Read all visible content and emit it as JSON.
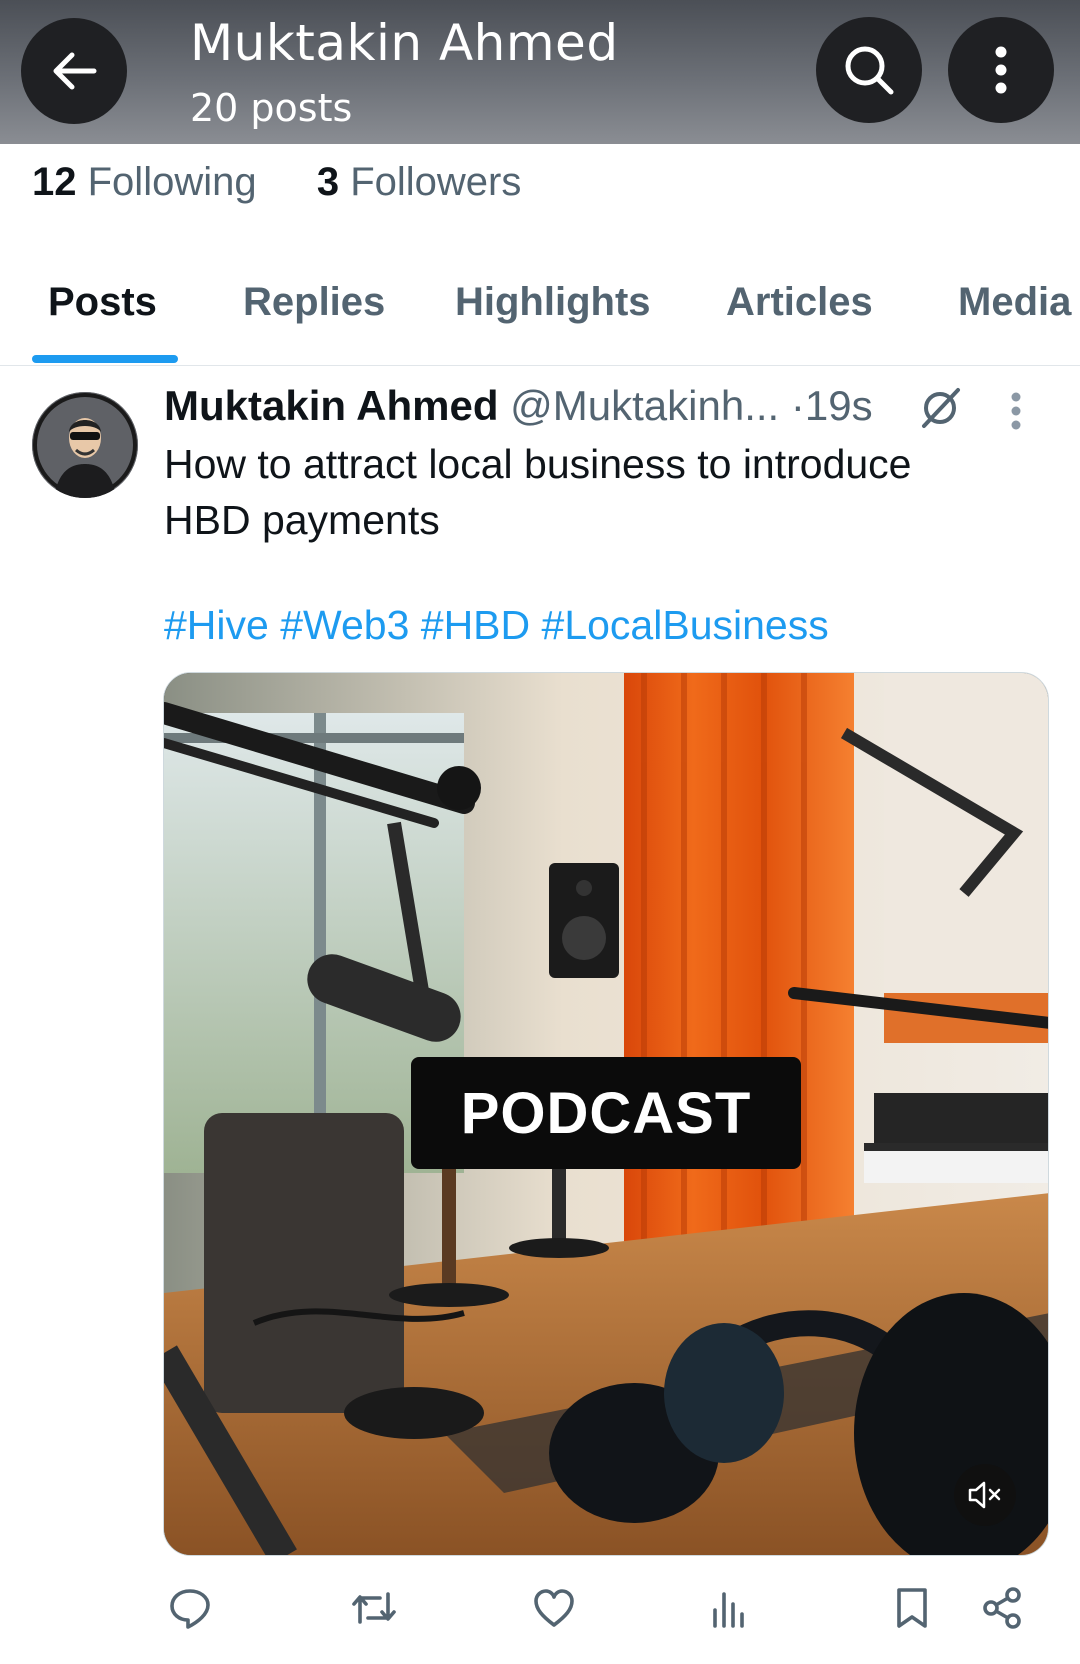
{
  "header": {
    "name": "Muktakin Ahmed",
    "posts_count": "20 posts",
    "back_icon": "arrow-left-icon",
    "search_icon": "search-icon",
    "more_icon": "more-vertical-icon"
  },
  "stats": {
    "following_count": "12",
    "following_label": "Following",
    "followers_count": "3",
    "followers_label": "Followers"
  },
  "tabs": [
    {
      "label": "Posts",
      "active": true
    },
    {
      "label": "Replies",
      "active": false
    },
    {
      "label": "Highlights",
      "active": false
    },
    {
      "label": "Articles",
      "active": false
    },
    {
      "label": "Media",
      "active": false
    }
  ],
  "post": {
    "author": "Muktakin Ahmed",
    "handle": "@Muktakinh...",
    "time": "·19s",
    "text": "How to attract local business to introduce HBD payments",
    "hashtags": "#Hive #Web3 #HBD #LocalBusiness",
    "media_label": "PODCAST",
    "actions": [
      "reply-icon",
      "repost-icon",
      "like-icon",
      "views-icon",
      "bookmark-icon",
      "share-icon"
    ]
  },
  "colors": {
    "accent": "#1d9bf0",
    "text_primary": "#0f1419",
    "text_secondary": "#536471"
  }
}
